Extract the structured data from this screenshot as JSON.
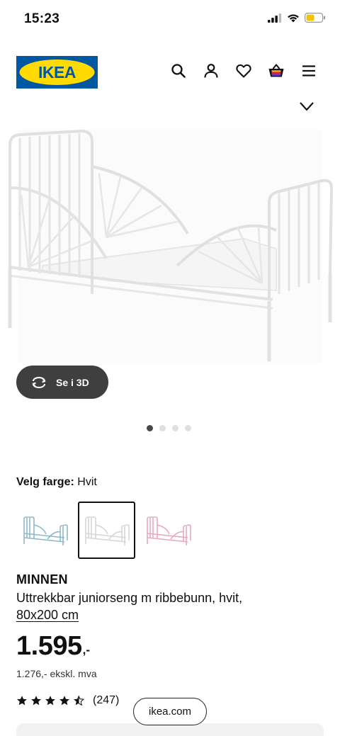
{
  "status_bar": {
    "time": "15:23"
  },
  "header": {
    "logo_text": "IKEA",
    "icons": [
      "search-icon",
      "account-icon",
      "heart-icon",
      "cart-icon",
      "menu-icon"
    ]
  },
  "viewer": {
    "button_3d_label": "Se i 3D",
    "carousel_total": 4,
    "carousel_active": 1
  },
  "color_picker": {
    "label": "Velg farge:",
    "selected_value": "Hvit",
    "options": [
      {
        "name": "blue-bed",
        "color": "#8fb8c8"
      },
      {
        "name": "white-bed",
        "color": "#d6d6d6"
      },
      {
        "name": "pink-bed",
        "color": "#e8a9c0"
      }
    ],
    "selected_index": 1
  },
  "product": {
    "name": "MINNEN",
    "description": "Uttrekkbar juniorseng m ribbebunn, hvit,",
    "size_link": "80x200 cm",
    "price": "1.595",
    "price_suffix": ",-",
    "price_ex_vat": "1.276,- ekskl. mva",
    "rating_stars": 4.5,
    "rating_count": "(247)"
  },
  "browser": {
    "url": "ikea.com"
  },
  "colors": {
    "ikea_blue": "#0058a3",
    "ikea_yellow": "#ffdb00",
    "text": "#111111",
    "button_dark": "#3f3f3f"
  }
}
